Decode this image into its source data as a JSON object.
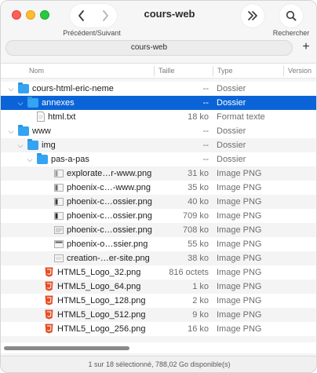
{
  "window": {
    "title": "cours-web",
    "nav_caption": "Précédent/Suivant",
    "search_caption": "Rechercher",
    "path": "cours-web",
    "add_label": "+"
  },
  "columns": {
    "name": "Nom",
    "size": "Taille",
    "kind": "Type",
    "version": "Version"
  },
  "rows": [
    {
      "name": "cours-html-eric-neme",
      "size": "--",
      "kind": "Dossier",
      "icon": "folder-icon",
      "chevron": "down"
    },
    {
      "name": "annexes",
      "size": "--",
      "kind": "Dossier",
      "icon": "folder-icon",
      "chevron": "down",
      "selected": true
    },
    {
      "name": "html.txt",
      "size": "18 ko",
      "kind": "Format texte",
      "icon": "text-file-icon"
    },
    {
      "name": "www",
      "size": "--",
      "kind": "Dossier",
      "icon": "folder-icon",
      "chevron": "down"
    },
    {
      "name": "img",
      "size": "--",
      "kind": "Dossier",
      "icon": "folder-icon",
      "chevron": "down"
    },
    {
      "name": "pas-a-pas",
      "size": "--",
      "kind": "Dossier",
      "icon": "folder-icon",
      "chevron": "down"
    },
    {
      "name": "explorate…r-www.png",
      "size": "31 ko",
      "kind": "Image PNG",
      "icon": "png-thumbnail-icon"
    },
    {
      "name": "phoenix-c…-www.png",
      "size": "35 ko",
      "kind": "Image PNG",
      "icon": "png-thumbnail-icon"
    },
    {
      "name": "phoenix-c…ossier.png",
      "size": "40 ko",
      "kind": "Image PNG",
      "icon": "png-thumbnail-icon"
    },
    {
      "name": "phoenix-c…ossier.png",
      "size": "709 ko",
      "kind": "Image PNG",
      "icon": "png-thumbnail-icon"
    },
    {
      "name": "phoenix-c…ossier.png",
      "size": "708 ko",
      "kind": "Image PNG",
      "icon": "png-thumbnail-icon"
    },
    {
      "name": "phoenix-o…ssier.png",
      "size": "55 ko",
      "kind": "Image PNG",
      "icon": "png-thumbnail-icon"
    },
    {
      "name": "creation-…er-site.png",
      "size": "38 ko",
      "kind": "Image PNG",
      "icon": "png-thumbnail-icon"
    },
    {
      "name": "HTML5_Logo_32.png",
      "size": "816 octets",
      "kind": "Image PNG",
      "icon": "html5-logo-icon"
    },
    {
      "name": "HTML5_Logo_64.png",
      "size": "1 ko",
      "kind": "Image PNG",
      "icon": "html5-logo-icon"
    },
    {
      "name": "HTML5_Logo_128.png",
      "size": "2 ko",
      "kind": "Image PNG",
      "icon": "html5-logo-icon"
    },
    {
      "name": "HTML5_Logo_512.png",
      "size": "9 ko",
      "kind": "Image PNG",
      "icon": "html5-logo-icon"
    },
    {
      "name": "HTML5_Logo_256.png",
      "size": "16 ko",
      "kind": "Image PNG",
      "icon": "html5-logo-icon"
    }
  ],
  "status": "1 sur 18 sélectionné, 788,02 Go disponible(s)",
  "colors": {
    "selection": "#0a64d8",
    "folder": "#34a3f2",
    "html5": "#e34f26"
  }
}
